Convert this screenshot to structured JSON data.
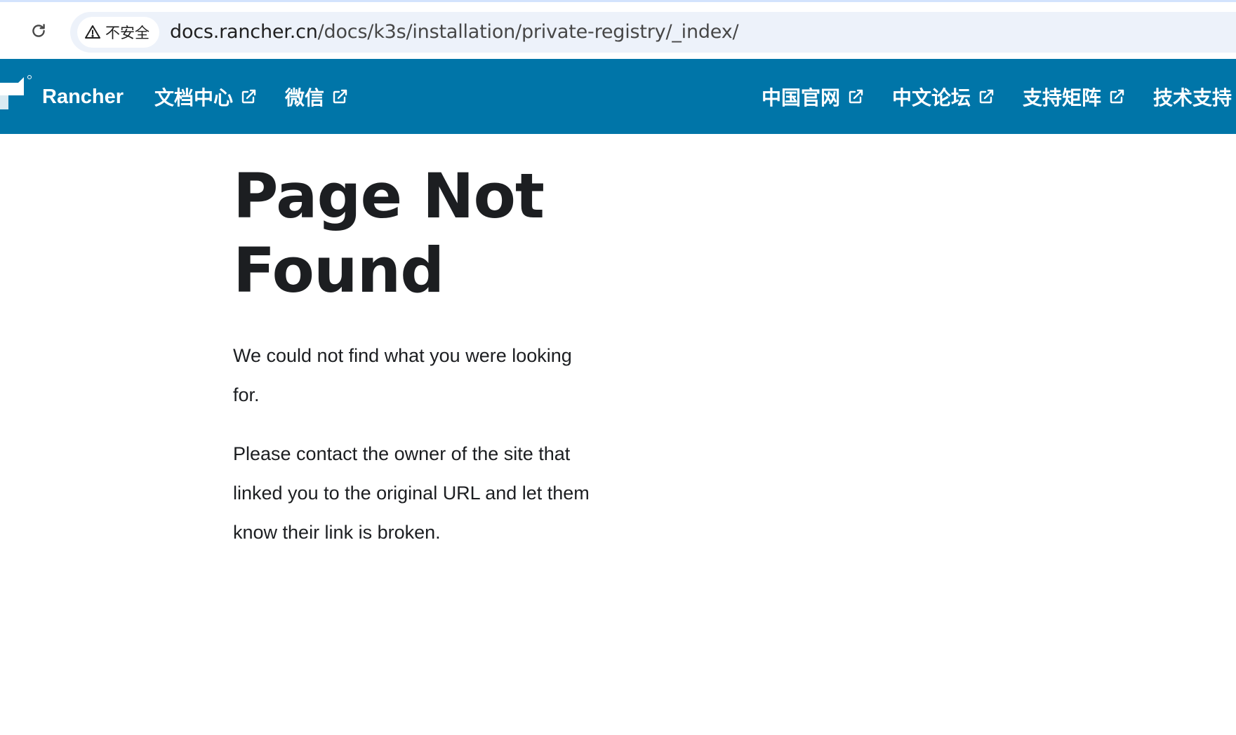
{
  "browser": {
    "security_label": "不安全",
    "url_host": "docs.rancher.cn",
    "url_path": "/docs/k3s/installation/private-registry/_index/"
  },
  "navbar": {
    "brand": "Rancher",
    "links_left": [
      {
        "label": "文档中心"
      },
      {
        "label": "微信"
      }
    ],
    "links_right": [
      {
        "label": "中国官网"
      },
      {
        "label": "中文论坛"
      },
      {
        "label": "支持矩阵"
      },
      {
        "label": "技术支持"
      }
    ],
    "background_color": "#0075a8"
  },
  "main": {
    "title": "Page Not Found",
    "paragraphs": [
      "We could not find what you were looking for.",
      "Please contact the owner of the site that linked you to the original URL and let them know their link is broken."
    ]
  },
  "icons": {
    "reload": "reload-icon",
    "warning": "warning-icon",
    "external_link": "external-link-icon",
    "logo": "rancher-logo-icon"
  }
}
